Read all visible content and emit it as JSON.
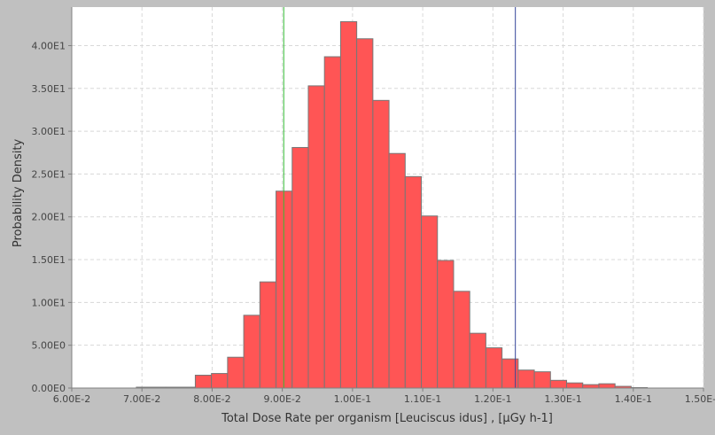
{
  "chart_data": {
    "type": "bar",
    "histogram": true,
    "title": "",
    "xlabel": "Total Dose Rate per organism [Leuciscus idus] , [µGy h-1]",
    "ylabel": "Probability Density",
    "xlim": [
      0.06,
      0.15
    ],
    "ylim": [
      0,
      44.5
    ],
    "x_ticks": [
      0.06,
      0.07,
      0.08,
      0.09,
      0.1,
      0.11,
      0.12,
      0.13,
      0.14,
      0.15
    ],
    "x_tick_labels": [
      "6.00E-2",
      "7.00E-2",
      "8.00E-2",
      "9.00E-2",
      "1.00E-1",
      "1.10E-1",
      "1.20E-1",
      "1.30E-1",
      "1.40E-1",
      "1.50E-1"
    ],
    "y_ticks": [
      0,
      5,
      10,
      15,
      20,
      25,
      30,
      35,
      40
    ],
    "y_tick_labels": [
      "0.00E0",
      "5.00E0",
      "1.00E1",
      "1.50E1",
      "2.00E1",
      "2.50E1",
      "3.00E1",
      "3.50E1",
      "4.00E1"
    ],
    "bin_edges": [
      0.0692,
      0.0734,
      0.0776,
      0.0799,
      0.0822,
      0.0845,
      0.0868,
      0.0891,
      0.0914,
      0.0937,
      0.096,
      0.0983,
      0.1006,
      0.1029,
      0.1052,
      0.1075,
      0.1098,
      0.1121,
      0.1144,
      0.1167,
      0.119,
      0.1213,
      0.1236,
      0.1259,
      0.1282,
      0.1305,
      0.1328,
      0.1351,
      0.1374,
      0.1397,
      0.142
    ],
    "values": [
      0.1,
      0.1,
      1.5,
      1.7,
      3.6,
      8.5,
      12.4,
      23.0,
      28.1,
      35.3,
      38.7,
      42.8,
      40.8,
      33.6,
      27.4,
      24.7,
      20.1,
      14.9,
      11.3,
      6.4,
      4.7,
      3.4,
      2.1,
      1.9,
      0.9,
      0.6,
      0.4,
      0.5,
      0.2,
      0.05
    ],
    "bar_color": "#ff5555",
    "bar_edge_color": "#777777",
    "plot_background": "#ffffff",
    "page_background": "#c0c0c0",
    "grid": true,
    "grid_color": "#d8d8d8",
    "markers": [
      {
        "x": 0.0902,
        "color": "#33bb33"
      },
      {
        "x": 0.1232,
        "color": "#334499"
      }
    ]
  }
}
